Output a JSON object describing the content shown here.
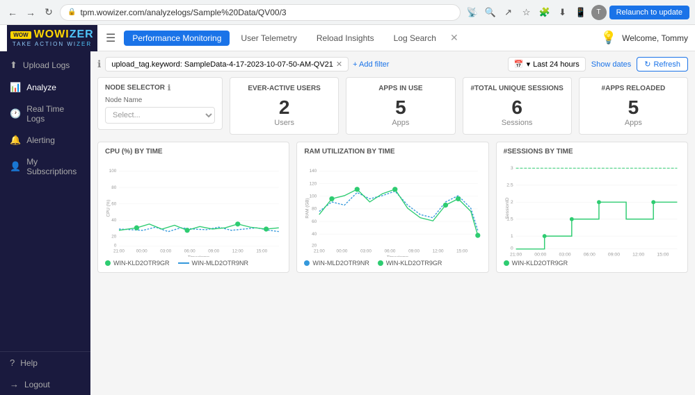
{
  "browser": {
    "url": "tpm.wowizer.com/analyzelogs/Sample%20Data/QV00/3",
    "back_title": "Back",
    "forward_title": "Forward",
    "reload_title": "Reload",
    "relaunch_label": "Relaunch to update"
  },
  "logo": {
    "text": "WOWI",
    "text2": "ER",
    "tagline": "TAKE ACTION WI",
    "tagline2": "ER"
  },
  "nav": {
    "hamburger": "☰",
    "tabs": [
      {
        "label": "Performance Monitoring",
        "active": true
      },
      {
        "label": "User Telemetry",
        "active": false
      },
      {
        "label": "Reload Insights",
        "active": false
      },
      {
        "label": "Log Search",
        "active": false
      }
    ],
    "close_icon": "✕",
    "welcome": "Welcome, Tommy"
  },
  "sidebar": {
    "items": [
      {
        "label": "Upload Logs",
        "icon": "⬆"
      },
      {
        "label": "Analyze",
        "icon": "📊"
      },
      {
        "label": "Real Time Logs",
        "icon": "🕐"
      },
      {
        "label": "Alerting",
        "icon": "🔔"
      },
      {
        "label": "My Subscriptions",
        "icon": "👤"
      }
    ],
    "bottom_items": [
      {
        "label": "Help",
        "icon": "?"
      },
      {
        "label": "Logout",
        "icon": "→"
      }
    ]
  },
  "filter": {
    "help_icon": "ℹ",
    "tag_text": "upload_tag.keyword: SampleData-4-17-2023-10-07-50-AM-QV21",
    "tag_close": "✕",
    "add_filter": "+ Add filter"
  },
  "date_controls": {
    "calendar_icon": "📅",
    "chevron_down": "▾",
    "date_range": "Last 24 hours",
    "show_dates_label": "Show dates",
    "refresh_icon": "↻",
    "refresh_label": "Refresh"
  },
  "node_selector": {
    "label": "NODE SELECTOR",
    "info_icon": "ℹ",
    "placeholder": "Select..."
  },
  "stats": [
    {
      "label": "EVER-ACTIVE USERS",
      "value": "2",
      "sub": "Users"
    },
    {
      "label": "APPS IN USE",
      "value": "5",
      "sub": "Apps"
    },
    {
      "label": "#TOTAL UNIQUE SESSIONS",
      "value": "6",
      "sub": "Sessions"
    },
    {
      "label": "#APPS RELOADED",
      "value": "5",
      "sub": "Apps"
    }
  ],
  "charts": [
    {
      "title": "CPU (%) BY TIME",
      "y_label": "CPU (%)",
      "x_label": "Timestamp",
      "y_max": 100,
      "legend": [
        {
          "label": "WIN-KLD2OTR9GR",
          "color": "#2ecc71",
          "type": "dot"
        },
        {
          "label": "WIN-MLD2OTR9NR",
          "color": "#3498db",
          "type": "line"
        }
      ]
    },
    {
      "title": "RAM UTILIZATION BY TIME",
      "y_label": "RAM (GB)",
      "x_label": "Timestamp",
      "y_max": 140,
      "legend": [
        {
          "label": "WIN-MLD2OTR9NR",
          "color": "#3498db",
          "type": "dot"
        },
        {
          "label": "WIN-KLD2OTR9GR",
          "color": "#2ecc71",
          "type": "dot"
        }
      ]
    },
    {
      "title": "#SESSIONS BY TIME",
      "y_label": "SessionID",
      "x_label": "Timestamp",
      "y_max": 3,
      "legend": [
        {
          "label": "WIN-KLD2OTR9GR",
          "color": "#2ecc71",
          "type": "dot"
        }
      ]
    }
  ],
  "time_labels": [
    "21:00",
    "00:00",
    "03:00",
    "06:00",
    "09:00",
    "12:00",
    "15:00"
  ]
}
